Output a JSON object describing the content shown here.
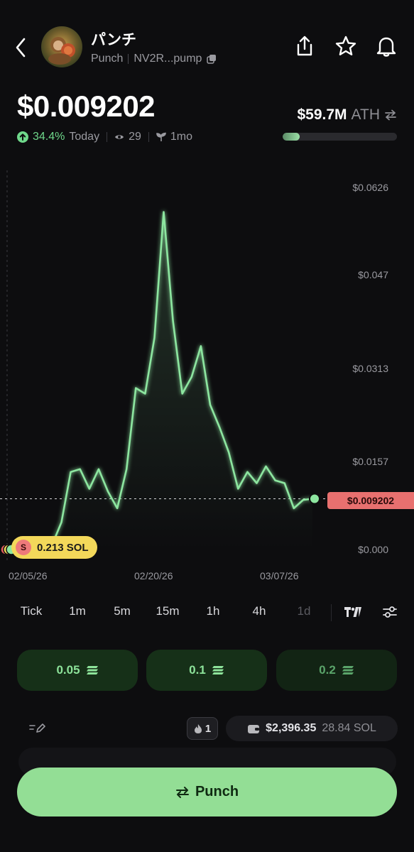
{
  "header": {
    "back_icon": "chevron-left-icon",
    "token_name": "パンチ",
    "symbol": "Punch",
    "address": "NV2R...pump",
    "copy_icon": "copy-icon",
    "actions": [
      "share-icon",
      "star-icon",
      "bell-icon"
    ]
  },
  "price": {
    "value": "$0.009202",
    "change_pct": "34.4%",
    "change_period": "Today",
    "watchers": "29",
    "age": "1mo"
  },
  "market_cap": {
    "value": "$59.7M",
    "ath_label": "ATH",
    "ath_progress_pct": 15
  },
  "chart": {
    "current_price_tag": "$0.009202",
    "trade_pill": {
      "side": "S",
      "amount": "0.213 SOL"
    }
  },
  "chart_data": {
    "type": "line",
    "title": "",
    "xlabel": "",
    "ylabel": "",
    "ylim": [
      0,
      0.0626
    ],
    "yticks": [
      "$0.0626",
      "$0.047",
      "$0.0313",
      "$0.0157",
      "$0.000"
    ],
    "xticks": [
      "02/05/26",
      "02/20/26",
      "03/07/26"
    ],
    "grid": false,
    "current_price": 0.009202,
    "series": [
      {
        "color": "#8de6a0",
        "x": [
          "02/05/26",
          "02/06/26",
          "02/07/26",
          "02/08/26",
          "02/09/26",
          "02/10/26",
          "02/11/26",
          "02/12/26",
          "02/13/26",
          "02/14/26",
          "02/15/26",
          "02/16/26",
          "02/17/26",
          "02/18/26",
          "02/19/26",
          "02/20/26",
          "02/21/26",
          "02/22/26",
          "02/23/26",
          "02/24/26",
          "02/25/26",
          "02/26/26",
          "02/27/26",
          "02/28/26",
          "03/01/26",
          "03/02/26",
          "03/03/26",
          "03/04/26",
          "03/05/26",
          "03/06/26",
          "03/07/26",
          "03/08/26",
          "03/09/26",
          "03/10/26"
        ],
        "y": [
          0.0002,
          0.0002,
          0.0003,
          0.0004,
          0.0006,
          0.001,
          0.005,
          0.014,
          0.0145,
          0.011,
          0.0145,
          0.0105,
          0.0075,
          0.0145,
          0.029,
          0.028,
          0.038,
          0.0605,
          0.041,
          0.028,
          0.031,
          0.0365,
          0.026,
          0.022,
          0.0175,
          0.011,
          0.014,
          0.012,
          0.015,
          0.0125,
          0.012,
          0.0075,
          0.009,
          0.0092
        ]
      }
    ]
  },
  "timeframes": {
    "items": [
      "Tick",
      "1m",
      "5m",
      "15m",
      "1h",
      "4h",
      "1d"
    ],
    "selected": "1d",
    "tools": [
      "tradingview-icon",
      "sliders-icon"
    ]
  },
  "quick_buy": [
    {
      "label": "0.05",
      "icon": "solana-icon"
    },
    {
      "label": "0.1",
      "icon": "solana-icon"
    },
    {
      "label": "0.2",
      "icon": "solana-icon"
    }
  ],
  "wallet": {
    "edit_icon": "edit-icon",
    "flame_count": "1",
    "usd": "$2,396.35",
    "sol": "28.84 SOL"
  },
  "action": {
    "label": "Punch",
    "icon": "swap-icon"
  }
}
